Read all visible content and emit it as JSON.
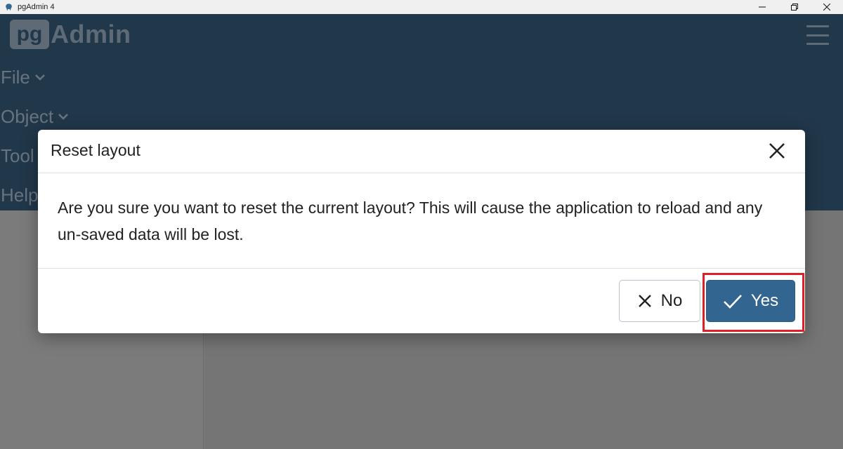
{
  "window": {
    "title": "pgAdmin 4",
    "app_icon": "elephant-icon",
    "controls": [
      "minimize-icon",
      "restore-icon",
      "close-icon"
    ]
  },
  "header": {
    "brand_pg": "pg",
    "brand_admin": "Admin",
    "menu_icon": "hamburger-icon",
    "menu": [
      {
        "label": "File"
      },
      {
        "label": "Object"
      },
      {
        "label": "Tool"
      },
      {
        "label": "Help"
      }
    ]
  },
  "dialog": {
    "title": "Reset layout",
    "message": "Are you sure you want to reset the current layout? This will cause the application to reload and any un-saved data will be lost.",
    "no_label": "No",
    "yes_label": "Yes",
    "close_icon": "close-icon",
    "highlighted_button": "Yes"
  },
  "colors": {
    "header_bg": "#2e4a63",
    "primary": "#326690",
    "highlight": "#e01e26"
  }
}
